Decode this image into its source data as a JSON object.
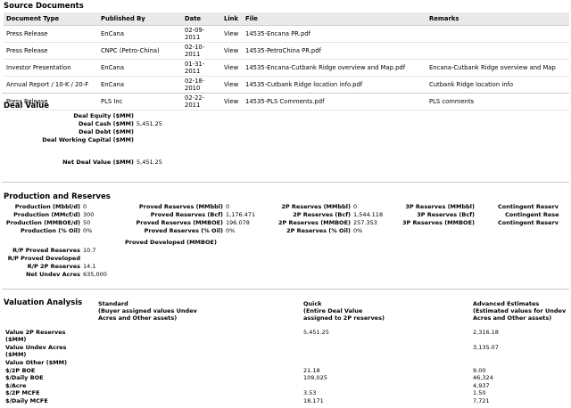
{
  "source_documents": {
    "title": "Source Documents",
    "columns": [
      "Document Type",
      "Published By",
      "Date",
      "Link",
      "File",
      "Remarks"
    ],
    "rows": [
      {
        "type": "Press Release",
        "publisher": "EnCana",
        "date": "02-09-2011",
        "link": "View",
        "file": "14535-Encana PR.pdf",
        "remarks": ""
      },
      {
        "type": "Press Release",
        "publisher": "CNPC (Petro-China)",
        "date": "02-10-2011",
        "link": "View",
        "file": "14535-PetroChina PR.pdf",
        "remarks": ""
      },
      {
        "type": "Investor Presentation",
        "publisher": "EnCana",
        "date": "01-31-2011",
        "link": "View",
        "file": "14535-Encana-Cutbank Ridge overview and Map.pdf",
        "remarks": "Encana-Cutbank Ridge overview and Map"
      },
      {
        "type": "Annual Report / 10-K / 20-F",
        "publisher": "EnCana",
        "date": "02-18-2010",
        "link": "View",
        "file": "14535-Cutbank Ridge location info.pdf",
        "remarks": "Cutbank Ridge location info"
      },
      {
        "type": "Press Release",
        "publisher": "PLS Inc",
        "date": "02-22-2011",
        "link": "View",
        "file": "14535-PLS Comments.pdf",
        "remarks": "PLS comments"
      }
    ]
  },
  "deal_value": {
    "title": "Deal Value",
    "equity_label": "Deal Equity ($MM)",
    "equity_value": "",
    "cash_label": "Deal Cash ($MM)",
    "cash_value": "5,451.25",
    "debt_label": "Deal Debt ($MM)",
    "debt_value": "",
    "wc_label": "Deal Working Capital ($MM)",
    "wc_value": "",
    "net_label": "Net Deal Value ($MM)",
    "net_value": "5,451.25"
  },
  "production": {
    "title": "Production and Reserves",
    "col1": [
      {
        "label": "Production (Mbbl/d)",
        "value": "0"
      },
      {
        "label": "Production (MMcf/d)",
        "value": "300"
      },
      {
        "label": "Production (MMBOE/d)",
        "value": "50"
      },
      {
        "label": "Production (% Oil)",
        "value": "0%"
      }
    ],
    "col2": [
      {
        "label": "Proved Reserves (MMbbl)",
        "value": "0"
      },
      {
        "label": "Proved Reserves (Bcf)",
        "value": "1,176.471"
      },
      {
        "label": "Proved Reserves (MMBOE)",
        "value": "196.078"
      },
      {
        "label": "Proved Reserves (% Oil)",
        "value": "0%"
      }
    ],
    "col3": [
      {
        "label": "2P Reserves (MMbbl)",
        "value": "0"
      },
      {
        "label": "2P Reserves (Bcf)",
        "value": "1,544.118"
      },
      {
        "label": "2P Reserves (MMBOE)",
        "value": "257.353"
      },
      {
        "label": "2P Reserves (% Oil)",
        "value": "0%"
      }
    ],
    "col4": [
      {
        "label": "3P Reserves (MMbbl)",
        "value": ""
      },
      {
        "label": "3P Reserves (Bcf)",
        "value": ""
      },
      {
        "label": "3P Reserves (MMBOE)",
        "value": ""
      }
    ],
    "col5": [
      {
        "label": "Contingent Reserv",
        "value": ""
      },
      {
        "label": "Contingent Rese",
        "value": ""
      },
      {
        "label": "Contingent Reserv",
        "value": ""
      }
    ],
    "proved_developed_label": "Proved Developed (MMBOE)",
    "rp_proved_label": "R/P Proved Reserves",
    "rp_proved_value": "10.7",
    "rp_proved_dev_label": "R/P Proved Developed",
    "rp_proved_dev_value": "",
    "rp_2p_label": "R/P 2P Reserves",
    "rp_2p_value": "14.1",
    "undev_label": "Net Undev Acres",
    "undev_value": "635,000"
  },
  "valuation": {
    "title": "Valuation Analysis",
    "header_standard": "Standard",
    "header_standard_sub1": "(Buyer assigned values Undev",
    "header_standard_sub2": "Acres and Other assets)",
    "header_quick": "Quick",
    "header_quick_sub1": "(Entire Deal Value",
    "header_quick_sub2": "assigned to 2P reserves)",
    "header_adv": "Advanced Estimates",
    "header_adv_sub1": "(Estimated values for Undev",
    "header_adv_sub2": "Acres and Other assets)",
    "rows": [
      {
        "label": "Value 2P Reserves",
        "label2": "($MM)",
        "standard": "",
        "quick": "5,451.25",
        "advanced": "2,316.18"
      },
      {
        "label": "Value Undev Acres",
        "label2": "($MM)",
        "standard": "",
        "quick": "",
        "advanced": "3,135.07"
      },
      {
        "label": "Value Other ($MM)",
        "label2": "",
        "standard": "",
        "quick": "",
        "advanced": ""
      },
      {
        "label": "$/2P BOE",
        "label2": "",
        "standard": "",
        "quick": "21.18",
        "advanced": "9.00"
      },
      {
        "label": "$/Daily BOE",
        "label2": "",
        "standard": "",
        "quick": "109,025",
        "advanced": "46,324"
      },
      {
        "label": "$/Acre",
        "label2": "",
        "standard": "",
        "quick": "",
        "advanced": "4,937"
      },
      {
        "label": "$/2P MCFE",
        "label2": "",
        "standard": "",
        "quick": "3.53",
        "advanced": "1.50"
      },
      {
        "label": "$/Daily MCFE",
        "label2": "",
        "standard": "",
        "quick": "18,171",
        "advanced": "7,721"
      }
    ]
  }
}
